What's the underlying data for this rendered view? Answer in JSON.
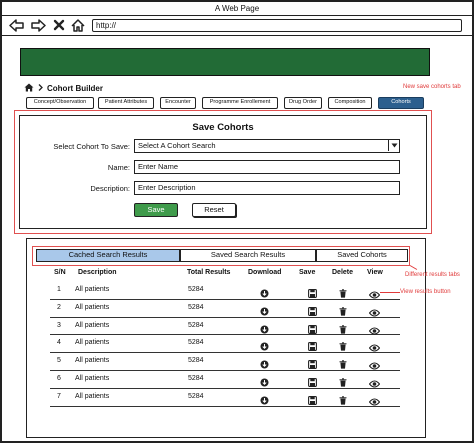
{
  "window": {
    "title": "A Web Page"
  },
  "browser": {
    "url": "http://"
  },
  "breadcrumb": {
    "label": "Cohort Builder"
  },
  "tabs": [
    {
      "label": "Concept/Observation"
    },
    {
      "label": "Patient Attributes"
    },
    {
      "label": "Encounter"
    },
    {
      "label": "Programme Enrollement"
    },
    {
      "label": "Drug Order"
    },
    {
      "label": "Composition"
    },
    {
      "label": "Cohorts"
    }
  ],
  "annotations": {
    "new_tab": "New save cohorts tab",
    "results_tabs": "Different results tabs",
    "view_button": "View results button"
  },
  "save_form": {
    "title": "Save Cohorts",
    "cohort_label": "Select Cohort To Save:",
    "cohort_value": "Select A Cohort Search",
    "name_label": "Name:",
    "name_value": "Enter Name",
    "description_label": "Description:",
    "description_value": "Enter Description",
    "save_label": "Save",
    "reset_label": "Reset"
  },
  "results_tabs": [
    {
      "label": "Cached Search Results"
    },
    {
      "label": "Saved Search Results"
    },
    {
      "label": "Saved Cohorts"
    }
  ],
  "table": {
    "headers": {
      "sn": "S/N",
      "description": "Description",
      "total": "Total Results",
      "download": "Download",
      "save": "Save",
      "delete": "Delete",
      "view": "View"
    },
    "rows": [
      {
        "sn": "1",
        "description": "All patients",
        "total": "5284"
      },
      {
        "sn": "2",
        "description": "All patients",
        "total": "5284"
      },
      {
        "sn": "3",
        "description": "All patients",
        "total": "5284"
      },
      {
        "sn": "4",
        "description": "All patients",
        "total": "5284"
      },
      {
        "sn": "5",
        "description": "All patients",
        "total": "5284"
      },
      {
        "sn": "6",
        "description": "All patients",
        "total": "5284"
      },
      {
        "sn": "7",
        "description": "All patients",
        "total": "5284"
      }
    ]
  },
  "colors": {
    "banner": "#226b36",
    "active_tab": "#2c5f8e",
    "save_button": "#3f9b4b",
    "annotation": "#e03a3a",
    "active_result_tab": "#a9c8ea"
  }
}
